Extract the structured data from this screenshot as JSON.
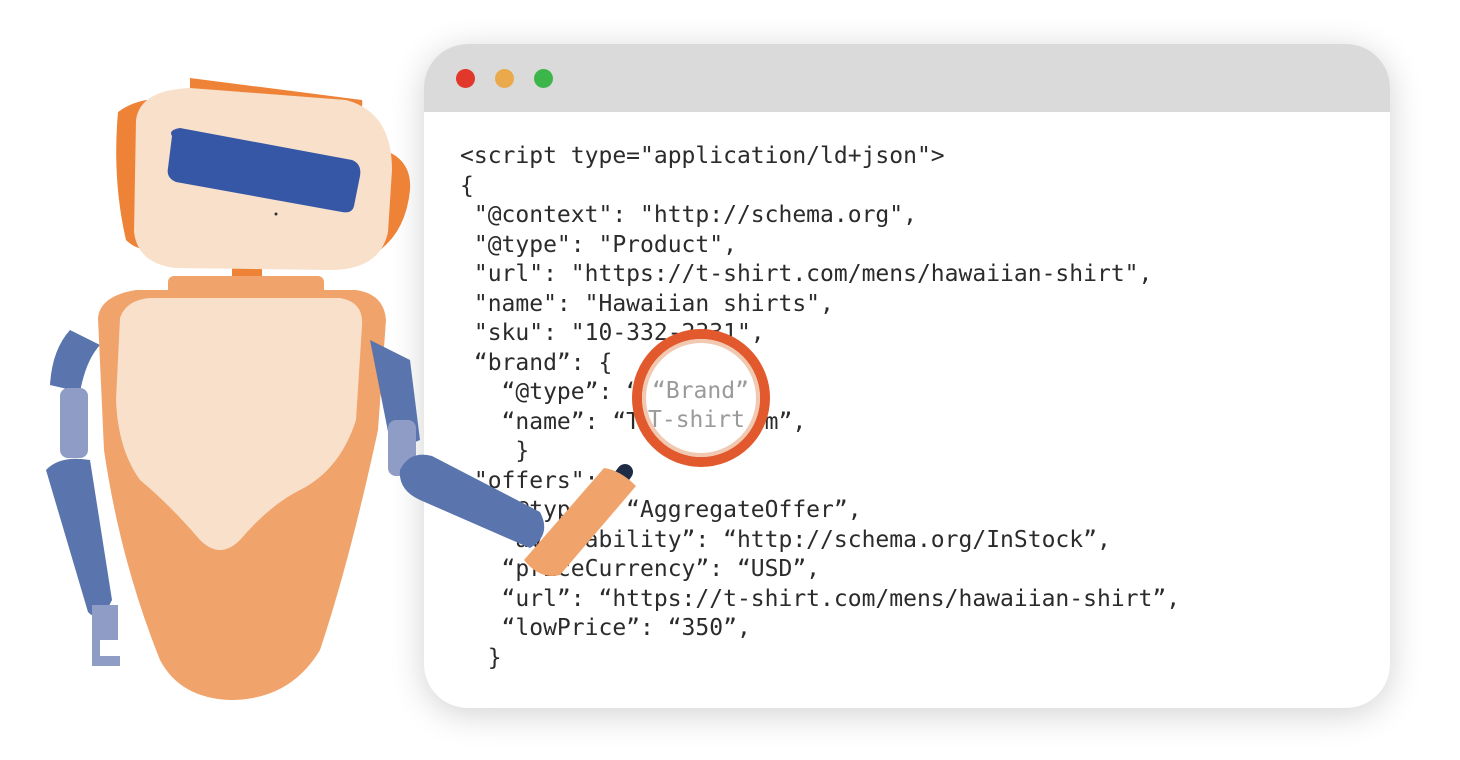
{
  "window": {
    "controls": [
      {
        "name": "close",
        "color": "#e2372b"
      },
      {
        "name": "minimize",
        "color": "#eaa94a"
      },
      {
        "name": "maximize",
        "color": "#3cb64b"
      }
    ],
    "code_lines": [
      "<script type=\"application/ld+json\">",
      "{",
      " \"@context\": \"http://schema.org\",",
      " \"@type\": \"Product\",",
      " \"url\": \"https://t-shirt.com/mens/hawaiian-shirt\",",
      " \"name\": \"Hawaiian shirts\",",
      " \"sku\": \"10-332-2331\",",
      " “brand”: {",
      "   “@type”: “Brand”,",
      "   “name”: “T-shirt.com”,",
      "    }",
      " \"offers\": {",
      "   “@type”: “AggregateOffer”,",
      "   “availability”: “http://schema.org/InStock”,",
      "   “priceCurrency”: “USD”,",
      "   “url”: “https://t-shirt.com/mens/hawaiian-shirt”,",
      "   “lowPrice”: “350”,",
      "  }"
    ]
  },
  "magnifier": {
    "line1": "“Brand”",
    "line2": "T-shirt"
  },
  "colors": {
    "robot_orange": "#f0a36a",
    "robot_dark_orange": "#ee8338",
    "robot_face": "#f8e0cb",
    "robot_visor": "#3657a5",
    "robot_blue": "#5a75ad",
    "robot_light_blue": "#8e9cc6",
    "magnifier_ring": "#e2592e"
  }
}
